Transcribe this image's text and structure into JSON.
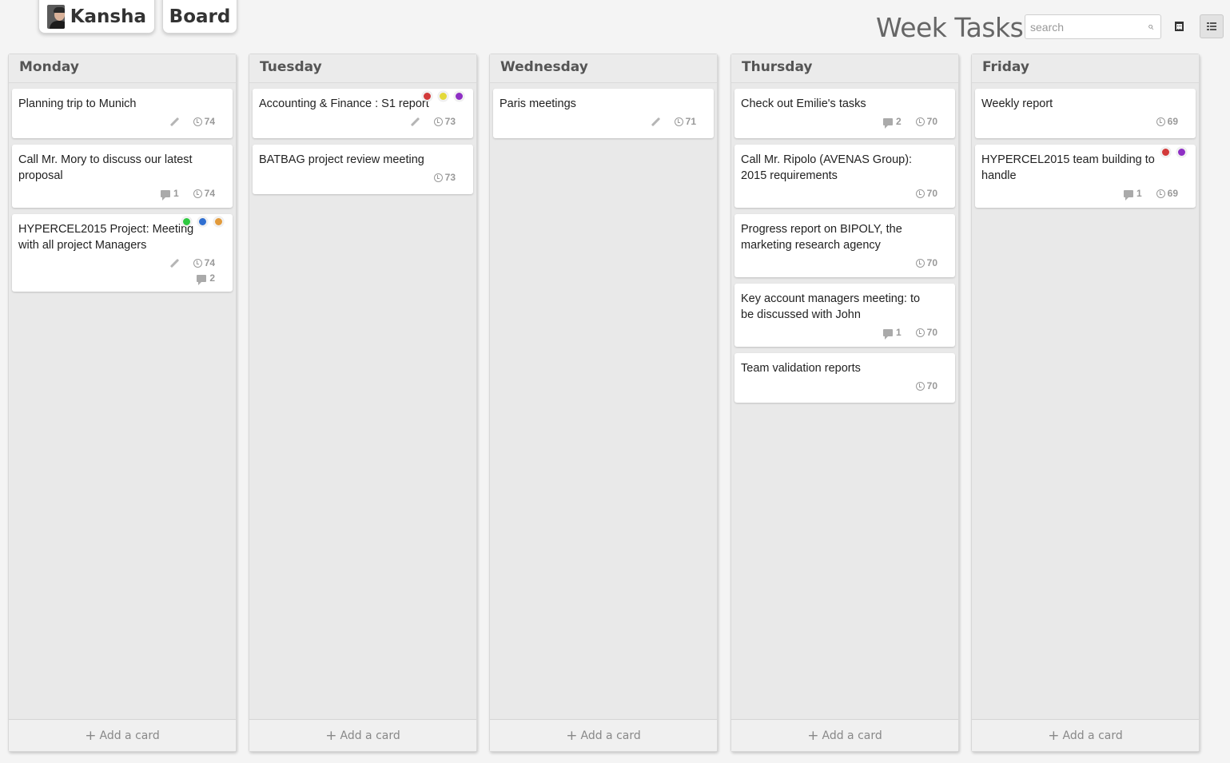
{
  "topbar": {
    "user_name": "Kansha",
    "board_label": "Board",
    "page_title": "Week Tasks",
    "search_placeholder": "search"
  },
  "add_card_label": "Add a card",
  "columns": [
    {
      "name": "Monday",
      "cards": [
        {
          "title": "Planning trip to Munich",
          "edit": true,
          "comments": null,
          "time": "74",
          "labels": []
        },
        {
          "title": "Call Mr. Mory to discuss our latest proposal",
          "edit": false,
          "comments": "1",
          "time": "74",
          "labels": []
        },
        {
          "title": "HYPERCEL2015 Project: Meeting with all project Managers",
          "edit": true,
          "comments": null,
          "time": "74",
          "extra_comments": "2",
          "labels": [
            "#2ec940",
            "#2f6fd1",
            "#e29a3b"
          ]
        }
      ]
    },
    {
      "name": "Tuesday",
      "cards": [
        {
          "title": "Accounting & Finance : S1 report",
          "edit": true,
          "comments": null,
          "time": "73",
          "labels": [
            "#d23a3a",
            "#e3d93a",
            "#8e2fc4"
          ]
        },
        {
          "title": "BATBAG project review meeting",
          "edit": false,
          "comments": null,
          "time": "73",
          "labels": []
        }
      ]
    },
    {
      "name": "Wednesday",
      "cards": [
        {
          "title": "Paris meetings",
          "edit": true,
          "comments": null,
          "time": "71",
          "labels": []
        }
      ]
    },
    {
      "name": "Thursday",
      "cards": [
        {
          "title": "Check out Emilie's tasks",
          "edit": false,
          "comments": "2",
          "time": "70",
          "labels": []
        },
        {
          "title": "Call Mr. Ripolo (AVENAS Group): 2015 requirements",
          "edit": false,
          "comments": null,
          "time": "70",
          "labels": []
        },
        {
          "title": "Progress report on BIPOLY, the marketing research agency",
          "edit": false,
          "comments": null,
          "time": "70",
          "labels": []
        },
        {
          "title": "Key account managers meeting: to be discussed with John",
          "edit": false,
          "comments": "1",
          "time": "70",
          "labels": []
        },
        {
          "title": "Team validation reports",
          "edit": false,
          "comments": null,
          "time": "70",
          "labels": []
        }
      ]
    },
    {
      "name": "Friday",
      "cards": [
        {
          "title": "Weekly report",
          "edit": false,
          "comments": null,
          "time": "69",
          "labels": []
        },
        {
          "title": "HYPERCEL2015 team building to handle",
          "edit": false,
          "comments": "1",
          "time": "69",
          "labels": [
            "#d23a3a",
            "#8e2fc4"
          ]
        }
      ]
    }
  ]
}
